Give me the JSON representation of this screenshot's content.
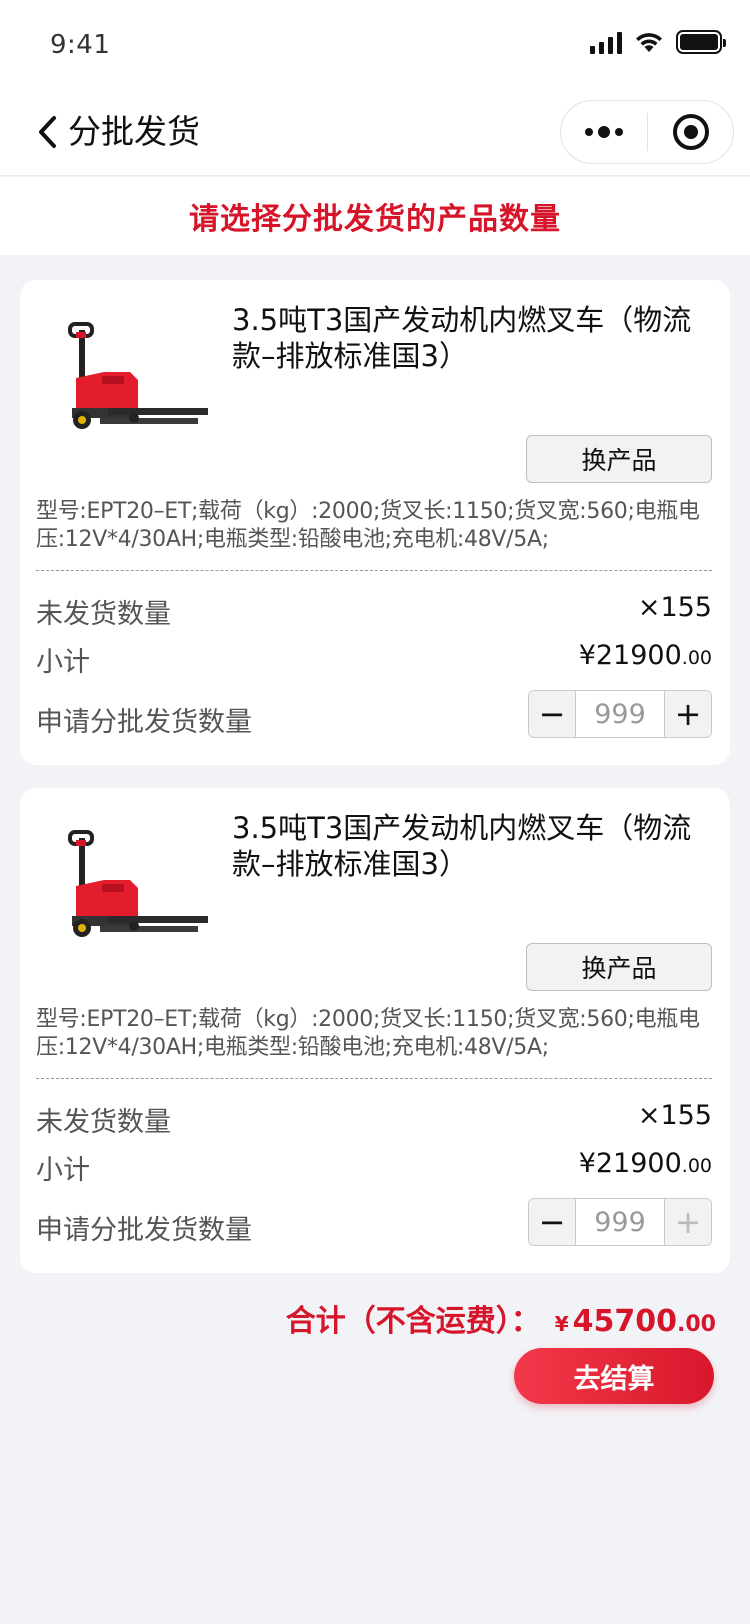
{
  "status_bar": {
    "time": "9:41"
  },
  "nav": {
    "title": "分批发货"
  },
  "notice": "请选择分批发货的产品数量",
  "products": [
    {
      "name": "3.5吨T3国产发动机内燃叉车（物流款–排放标准国3）",
      "swap_label": "换产品",
      "specs": "型号:EPT20–ET;载荷（kg）:2000;货叉长:1150;货叉宽:560;电瓶电压:12V*4/30AH;电瓶类型:铅酸电池;充电机:48V/5A;",
      "unshipped_label": "未发货数量",
      "unshipped_value": "×155",
      "subtotal_label": "小计",
      "subtotal_int": "¥21900",
      "subtotal_dec": ".00",
      "apply_label": "申请分批发货数量",
      "qty": "999",
      "minus": "−",
      "plus": "+"
    },
    {
      "name": "3.5吨T3国产发动机内燃叉车（物流款–排放标准国3）",
      "swap_label": "换产品",
      "specs": "型号:EPT20–ET;载荷（kg）:2000;货叉长:1150;货叉宽:560;电瓶电压:12V*4/30AH;电瓶类型:铅酸电池;充电机:48V/5A;",
      "unshipped_label": "未发货数量",
      "unshipped_value": "×155",
      "subtotal_label": "小计",
      "subtotal_int": "¥21900",
      "subtotal_dec": ".00",
      "apply_label": "申请分批发货数量",
      "qty": "999",
      "minus": "−",
      "plus": "+"
    }
  ],
  "total": {
    "label": "合计（不含运费）：",
    "yen": "¥",
    "int": "45700",
    "dec": ".00"
  },
  "checkout_label": "去结算",
  "colors": {
    "accent": "#d6152a",
    "background": "#f2f3f7"
  },
  "icons": [
    "back-chevron-icon",
    "more-dots-icon",
    "close-target-icon",
    "signal-icon",
    "wifi-icon",
    "battery-icon"
  ]
}
